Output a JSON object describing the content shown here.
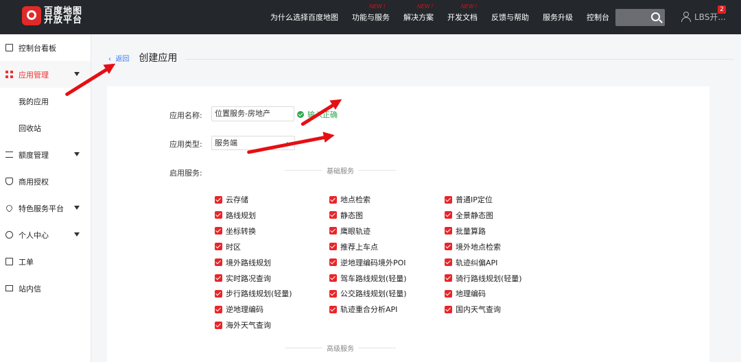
{
  "header": {
    "logo_line1": "百度地图",
    "logo_line2": "开放平台",
    "logo_mark": "du",
    "nav": [
      {
        "label": "为什么选择百度地图",
        "badge": ""
      },
      {
        "label": "功能与服务",
        "badge": "NEW !"
      },
      {
        "label": "解决方案",
        "badge": "NEW !"
      },
      {
        "label": "开发文档",
        "badge": "NEW !"
      },
      {
        "label": "反馈与帮助",
        "badge": ""
      },
      {
        "label": "服务升级",
        "badge": ""
      },
      {
        "label": "控制台",
        "badge": ""
      }
    ],
    "user_label": "LBS开...",
    "message_count": "2"
  },
  "sidebar": {
    "items": [
      {
        "label": "控制台看板"
      },
      {
        "label": "应用管理"
      },
      {
        "label": "我的应用"
      },
      {
        "label": "回收站"
      },
      {
        "label": "额度管理"
      },
      {
        "label": "商用授权"
      },
      {
        "label": "特色服务平台"
      },
      {
        "label": "个人中心"
      },
      {
        "label": "工单"
      },
      {
        "label": "站内信"
      }
    ]
  },
  "main": {
    "back_label": "返回",
    "title": "创建应用",
    "form": {
      "app_name_label": "应用名称:",
      "app_name_value": "位置服务-房地产",
      "valid_text": "输入正确",
      "app_type_label": "应用类型:",
      "app_type_value": "服务端",
      "services_label": "启用服务:",
      "basic_section": "基础服务",
      "advanced_section": "高级服务"
    },
    "services": [
      [
        "云存储",
        "地点检索",
        "普通IP定位"
      ],
      [
        "路线规划",
        "静态图",
        "全景静态图"
      ],
      [
        "坐标转换",
        "鹰眼轨迹",
        "批量算路"
      ],
      [
        "时区",
        "推荐上车点",
        "境外地点检索"
      ],
      [
        "境外路线规划",
        "逆地理编码境外POI",
        "轨迹纠偏API"
      ],
      [
        "实时路况查询",
        "驾车路线规划(轻量)",
        "骑行路线规划(轻量)"
      ],
      [
        "步行路线规划(轻量)",
        "公交路线规划(轻量)",
        "地理编码"
      ],
      [
        "逆地理编码",
        "轨迹重合分析API",
        "国内天气查询"
      ],
      [
        "海外天气查询"
      ]
    ]
  },
  "colors": {
    "topbar": "#24272c",
    "accent_red": "#e8262a",
    "valid_green": "#2fa74f",
    "link_blue": "#3478f6"
  }
}
